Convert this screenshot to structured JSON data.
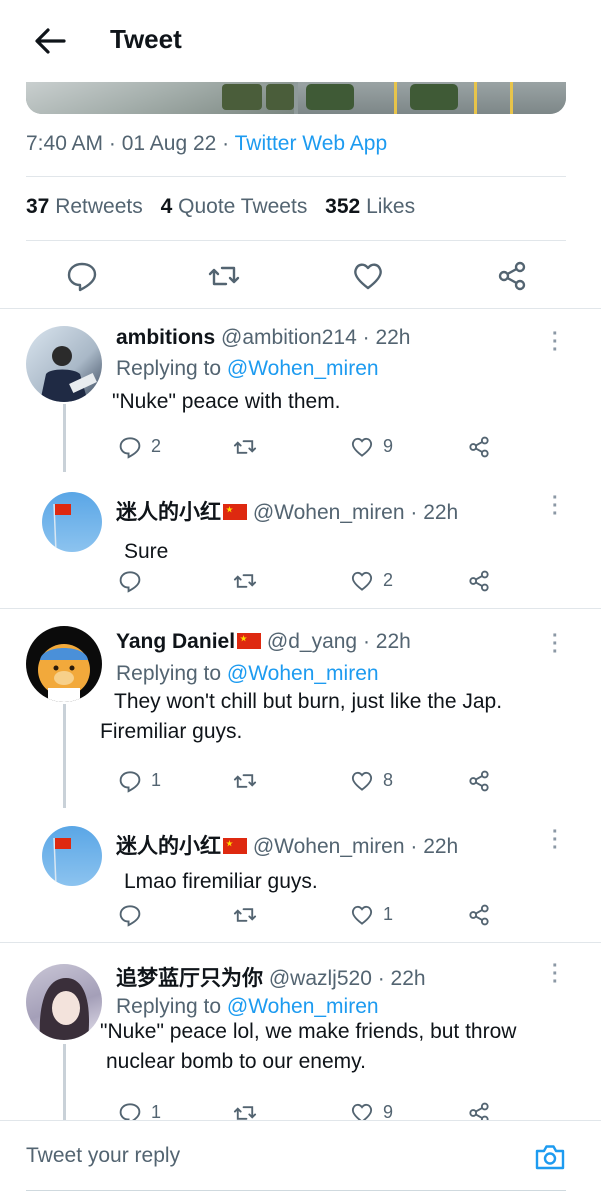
{
  "header": {
    "title": "Tweet",
    "back_icon": "arrow-left-icon"
  },
  "tweet": {
    "time": "7:40 AM",
    "date": "01 Aug 22",
    "source": "Twitter Web App",
    "retweets_count": "37",
    "retweets_label": "Retweets",
    "quotes_count": "4",
    "quotes_label": "Quote Tweets",
    "likes_count": "352",
    "likes_label": "Likes"
  },
  "replies": [
    {
      "name": "ambitions",
      "handle": "@ambition214",
      "time": "22h",
      "replying_label": "Replying to",
      "replying_to": "@Wohen_miren",
      "text": [
        "\"Nuke\" peace with them."
      ],
      "reply_count": "2",
      "retweet_count": "",
      "like_count": "9"
    },
    {
      "name": "迷人的小红",
      "handle": "@Wohen_miren",
      "time": "22h",
      "text": [
        "Sure"
      ],
      "reply_count": "",
      "retweet_count": "",
      "like_count": "2"
    },
    {
      "name": "Yang Daniel",
      "handle": "@d_yang",
      "time": "22h",
      "replying_label": "Replying to",
      "replying_to": "@Wohen_miren",
      "text": [
        "They won't chill but burn, just like the Jap.",
        "Firemiliar guys."
      ],
      "reply_count": "1",
      "retweet_count": "",
      "like_count": "8"
    },
    {
      "name": "迷人的小红",
      "handle": "@Wohen_miren",
      "time": "22h",
      "text": [
        "Lmao firemiliar guys."
      ],
      "reply_count": "",
      "retweet_count": "",
      "like_count": "1"
    },
    {
      "name": "追梦蓝厅只为你",
      "handle": "@wazlj520",
      "time": "22h",
      "replying_label": "Replying to",
      "replying_to": "@Wohen_miren",
      "text": [
        "\"Nuke\" peace lol, we make friends, but throw",
        "nuclear bomb to our enemy."
      ],
      "reply_count": "1",
      "retweet_count": "",
      "like_count": "9"
    }
  ],
  "reply_box": {
    "placeholder": "Tweet your reply",
    "camera_icon": "camera-icon"
  },
  "colors": {
    "accent": "#1d9bf0",
    "text": "#0f1419",
    "secondary": "#536471",
    "divider": "#e1e6ea"
  }
}
